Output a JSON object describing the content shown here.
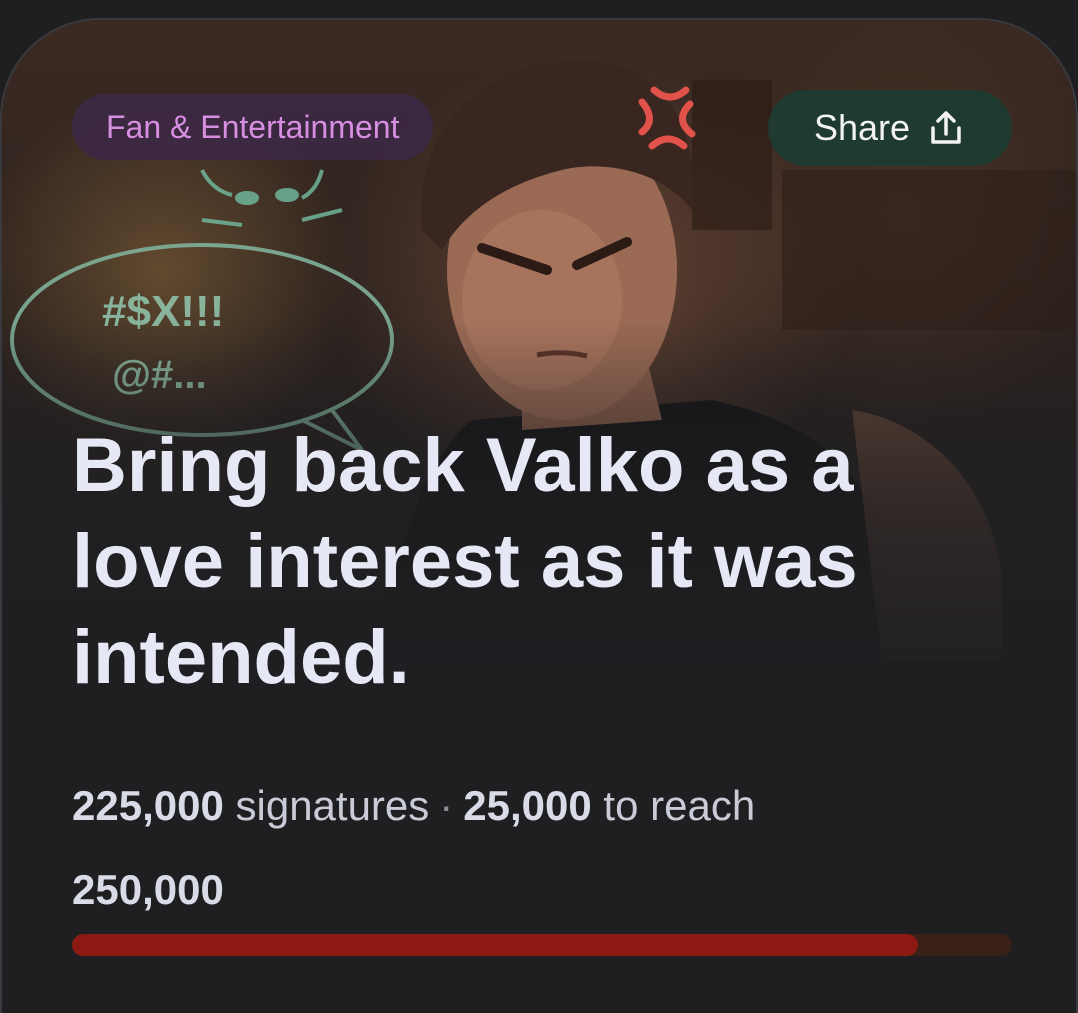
{
  "petition": {
    "category": "Fan & Entertainment",
    "share_label": "Share",
    "title": "Bring back Valko as a love interest as it was intended.",
    "signatures_count": "225,000",
    "signatures_label": "signatures",
    "remaining_count": "25,000",
    "remaining_label": "to reach",
    "goal": "250,000",
    "progress_fraction": 0.9
  },
  "hero_image": {
    "speech_bubble_text_line1": "#$X!!!",
    "speech_bubble_text_line2": "@#..."
  },
  "icons": {
    "share": "share-upload-icon",
    "anger": "anger-mark-icon"
  },
  "colors": {
    "background": "#1f1f22",
    "chip_bg": "#3c2846",
    "chip_text": "#d68fe0",
    "share_bg": "#1e3a31",
    "title_text": "#e6e9f5",
    "progress_fill": "#8c1a12",
    "progress_track": "#3a2118"
  }
}
